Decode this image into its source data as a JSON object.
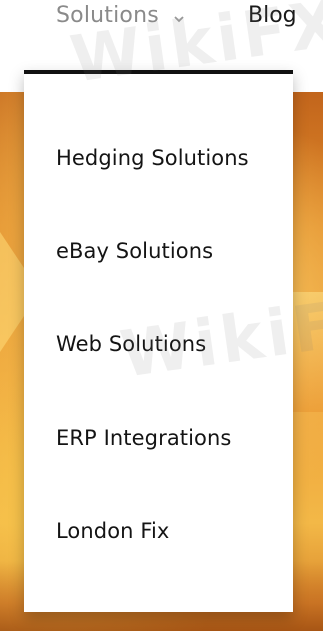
{
  "nav": {
    "solutions_label": "Solutions",
    "blog_label": "Blog"
  },
  "dropdown": {
    "items": [
      {
        "label": "Hedging Solutions"
      },
      {
        "label": "eBay Solutions"
      },
      {
        "label": "Web Solutions"
      },
      {
        "label": "ERP Integrations"
      },
      {
        "label": "London Fix"
      }
    ]
  },
  "watermark": "WikiFX",
  "colors": {
    "nav_inactive": "#8a8a8a",
    "nav_active": "#1a1a1a",
    "dropdown_border": "#111111",
    "hero_orange": "#eea13a"
  }
}
